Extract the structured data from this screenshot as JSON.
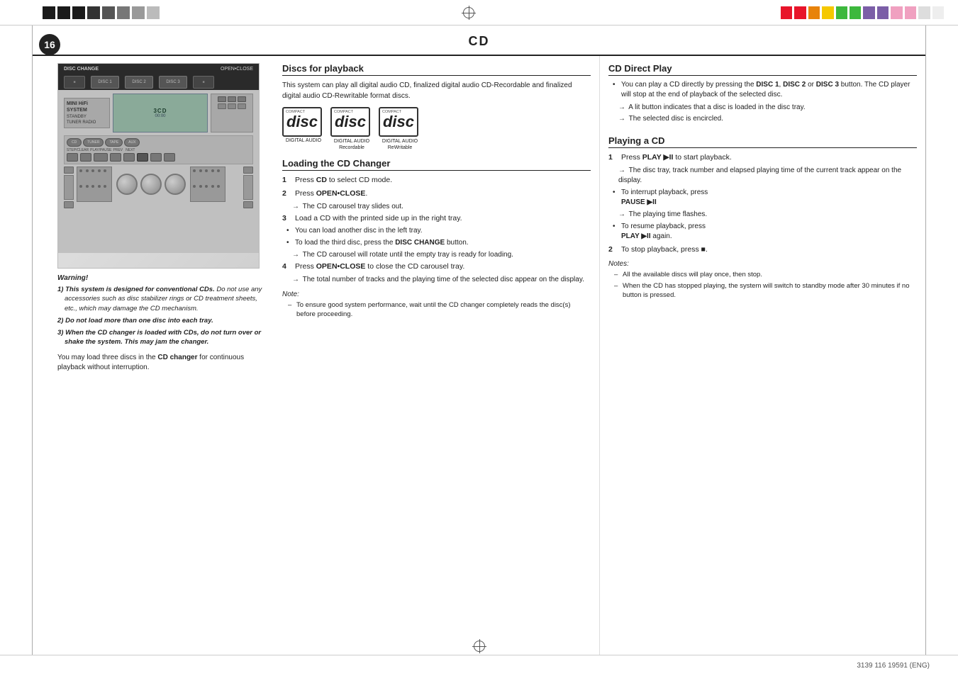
{
  "header": {
    "page_number": "16",
    "title": "CD",
    "footer_text": "3139 116 19591 (ENG)"
  },
  "colors": {
    "header_squares": [
      "#1a1a1a",
      "#1a1a1a",
      "#1a1a1a",
      "#1a1a1a",
      "#1a1a1a",
      "#1a1a1a",
      "#1a1a1a",
      "#1a1a1a"
    ],
    "color_squares": [
      "#e8142a",
      "#e8142a",
      "#e8830a",
      "#f5c800",
      "#3db83d",
      "#3db83d",
      "#3db83d",
      "#3db83d",
      "#7b5ea7",
      "#7b5ea7",
      "#f0a0c0",
      "#f0a0c0"
    ]
  },
  "device": {
    "disc_change_label": "DISC CHANGE",
    "open_close_label": "OPEN•CLOSE",
    "disc1_label": "DISC 1",
    "disc2_label": "DISC 2",
    "disc3_label": "DISC 3",
    "brand": "MINI HiFi SYSTEM",
    "model": "3CD"
  },
  "warning": {
    "title": "Warning!",
    "items": [
      "1) This system is designed for conventional CDs. Do not use any accessories such as disc stabilizer rings or CD treatment sheets, etc., which may damage the CD mechanism.",
      "2) Do not load more than one disc into each tray.",
      "3) When the CD changer is loaded with CDs, do not turn over or shake the system. This may jam the changer."
    ],
    "continuous_note": "You may load three discs in the CD changer for continuous playback without interruption."
  },
  "discs_section": {
    "heading": "Discs for playback",
    "intro": "This system can play all digital audio CD, finalized digital audio CD-Recordable and finalized digital audio CD-Rewritable format discs.",
    "disc_icons": [
      {
        "label": "COMPACT",
        "sub": "disc",
        "bottom": "DIGITAL AUDIO"
      },
      {
        "label": "COMPACT",
        "sub": "disc",
        "bottom": "DIGITAL AUDIO\nRecordable"
      },
      {
        "label": "COMPACT",
        "sub": "disc",
        "bottom": "DIGITAL AUDIO\nReWritable"
      }
    ]
  },
  "loading_section": {
    "heading": "Loading the CD Changer",
    "steps": [
      {
        "num": "1",
        "text": "Press ",
        "bold": "CD",
        "after": " to select CD mode."
      },
      {
        "num": "2",
        "text": "Press ",
        "bold": "OPEN•CLOSE",
        "after": "."
      },
      {
        "num": "2a",
        "arrow": true,
        "text": "The CD carousel tray slides out."
      },
      {
        "num": "3",
        "text": "Load a CD with the printed side up in the right tray."
      },
      {
        "num": "b1",
        "bullet": true,
        "text": "You can load another disc in the left tray."
      },
      {
        "num": "b2",
        "bullet": true,
        "text": "To load the third disc, press the ",
        "bold": "DISC CHANGE",
        "after": " button."
      },
      {
        "num": "3a",
        "arrow": true,
        "text": "The CD carousel will rotate until the empty tray is ready for loading."
      },
      {
        "num": "4",
        "text": "Press ",
        "bold": "OPEN•CLOSE",
        "after": " to close the CD carousel tray."
      },
      {
        "num": "4a",
        "arrow": true,
        "text": "The total number of tracks and the playing time of the selected disc appear on the display."
      }
    ],
    "note_label": "Note:",
    "note": "– To ensure good system performance, wait until the CD changer completely reads the disc(s) before proceeding."
  },
  "cd_direct_play": {
    "heading": "CD Direct Play",
    "intro": "You can play a CD directly by pressing the ",
    "disc1_bold": "DISC 1",
    "disc2_bold": "DISC 2",
    "disc3_bold": "DISC 3",
    "intro_after": " button. The CD player will stop at the end of playback of the selected disc.",
    "arrows": [
      "A lit button indicates that a disc is loaded in the disc tray.",
      "The selected disc is encircled."
    ]
  },
  "playing_section": {
    "heading": "Playing a CD",
    "steps": [
      {
        "num": "1",
        "text": "Press ",
        "bold": "PLAY ▶II",
        "after": " to start playback."
      },
      {
        "num": "1a",
        "arrow": true,
        "text": "The disc tray, track number and elapsed playing time of the current track appear on the display."
      },
      {
        "num": "b1",
        "bullet": true,
        "text": "To interrupt playback, press "
      },
      {
        "num": "b1_bold",
        "bold_text": "PAUSE ▶II"
      },
      {
        "num": "b1a",
        "arrow": true,
        "text": "The playing time flashes."
      },
      {
        "num": "b2",
        "bullet": true,
        "text": "To resume playback, press "
      },
      {
        "num": "b2_bold",
        "bold_text": "PLAY ▶II again."
      },
      {
        "num": "2",
        "text": "To stop playback, press ■."
      }
    ],
    "notes_label": "Notes:",
    "notes": [
      "All the available discs will play once, then stop.",
      "When the CD has stopped playing, the system will switch to standby mode after 30 minutes if no button is pressed."
    ]
  }
}
